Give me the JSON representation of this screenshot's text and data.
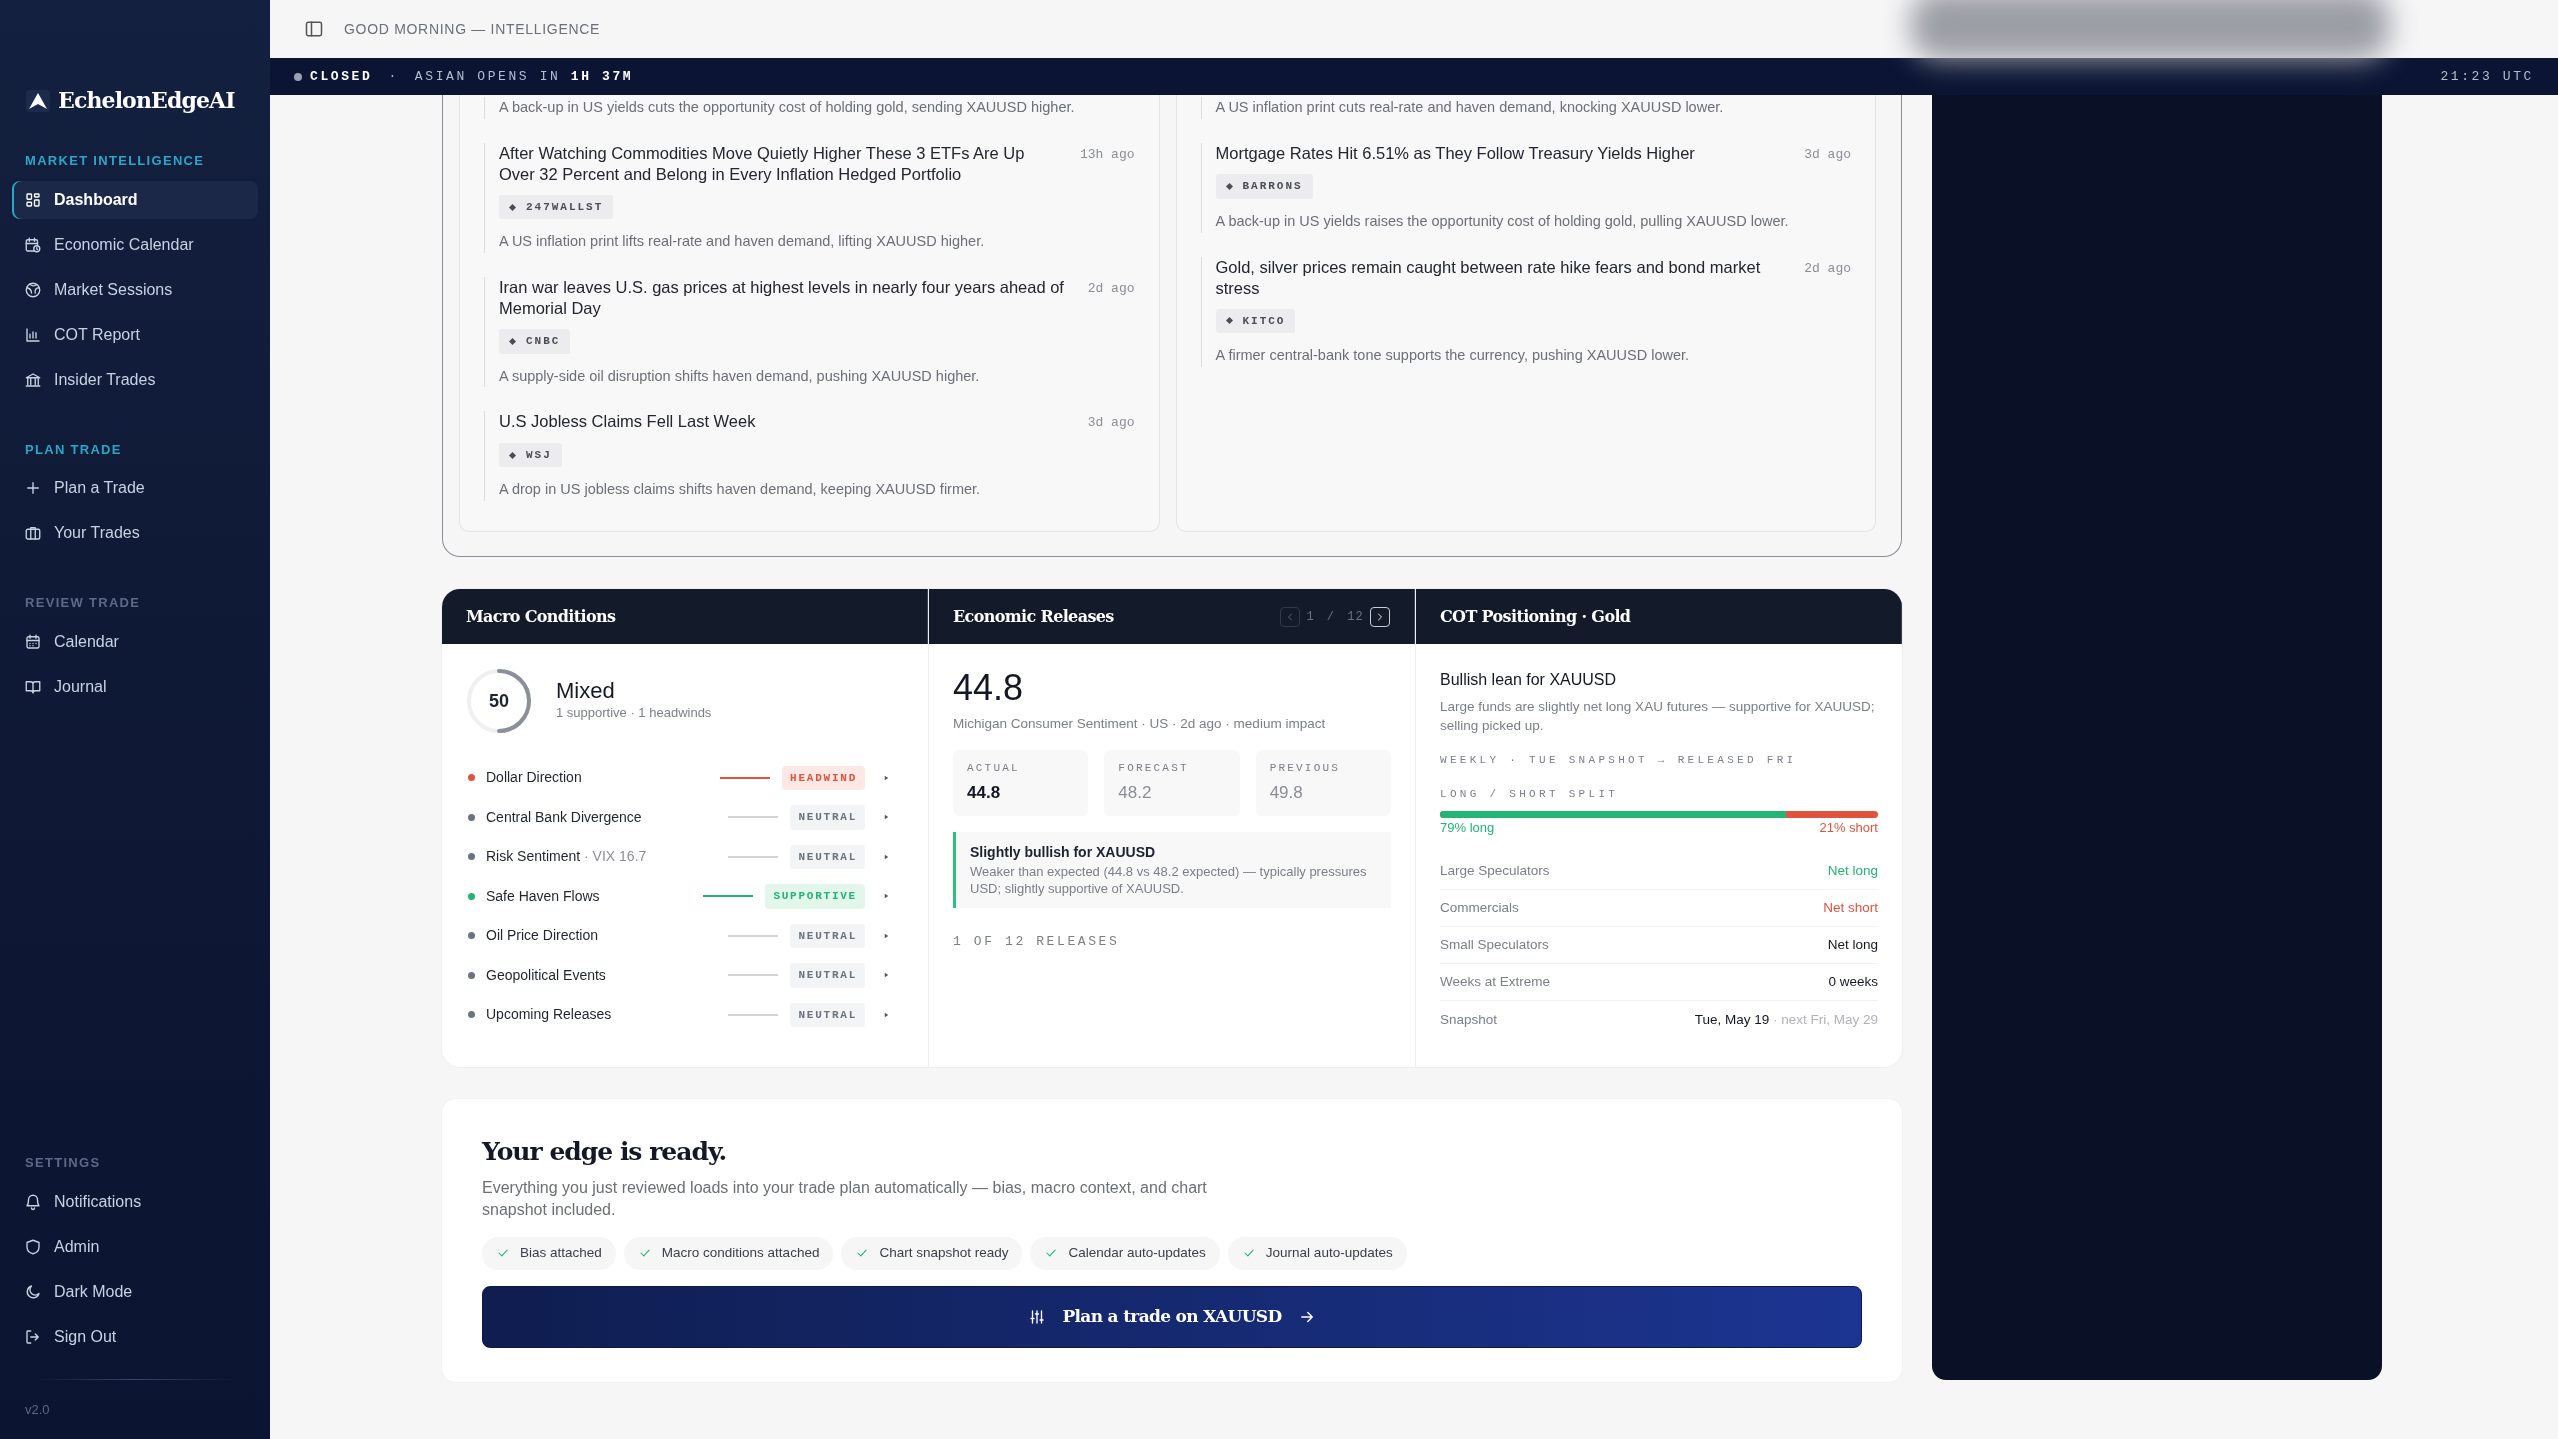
{
  "header": {
    "title": "GOOD MORNING — INTELLIGENCE"
  },
  "status_bar": {
    "state": "CLOSED",
    "separator": "·",
    "countdown_label": "ASIAN OPENS IN",
    "countdown": "1H 37M",
    "clock": "21:23 UTC"
  },
  "sidebar": {
    "brand": "EchelonEdgeAI",
    "sections": [
      {
        "title": "MARKET INTELLIGENCE",
        "accent": true,
        "items": [
          {
            "label": "Dashboard",
            "selected": true
          },
          {
            "label": "Economic Calendar",
            "selected": false
          },
          {
            "label": "Market Sessions",
            "selected": false
          },
          {
            "label": "COT Report",
            "selected": false
          },
          {
            "label": "Insider Trades",
            "selected": false
          }
        ]
      },
      {
        "title": "PLAN TRADE",
        "accent": true,
        "items": [
          {
            "label": "Plan a Trade",
            "selected": false
          },
          {
            "label": "Your Trades",
            "selected": false
          }
        ]
      },
      {
        "title": "REVIEW TRADE",
        "accent": false,
        "items": [
          {
            "label": "Calendar",
            "selected": false
          },
          {
            "label": "Journal",
            "selected": false
          }
        ]
      },
      {
        "title": "SETTINGS",
        "accent": false,
        "items": [
          {
            "label": "Notifications",
            "selected": false
          },
          {
            "label": "Admin",
            "selected": false
          },
          {
            "label": "Dark Mode",
            "selected": false
          },
          {
            "label": "Sign Out",
            "selected": false
          }
        ]
      }
    ],
    "version": "v2.0"
  },
  "news": {
    "columns": [
      [
        {
          "summary": "A back-up in US yields cuts the opportunity cost of holding gold, sending XAUUSD higher."
        },
        {
          "title": "After Watching Commodities Move Quietly Higher These 3 ETFs Are Up Over 32 Percent and Belong in Every Inflation Hedged Portfolio",
          "time": "13h ago",
          "source": "247WALLST",
          "summary": "A US inflation print lifts real-rate and haven demand, lifting XAUUSD higher."
        },
        {
          "title": "Iran war leaves U.S. gas prices at highest levels in nearly four years ahead of Memorial Day",
          "time": "2d ago",
          "source": "CNBC",
          "summary": "A supply-side oil disruption shifts haven demand, pushing XAUUSD higher."
        },
        {
          "title": "U.S Jobless Claims Fell Last Week",
          "time": "3d ago",
          "source": "WSJ",
          "summary": "A drop in US jobless claims shifts haven demand, keeping XAUUSD firmer."
        }
      ],
      [
        {
          "summary": "A US inflation print cuts real-rate and haven demand, knocking XAUUSD lower."
        },
        {
          "title": "Mortgage Rates Hit 6.51% as They Follow Treasury Yields Higher",
          "time": "3d ago",
          "source": "BARRONS",
          "summary": "A back-up in US yields raises the opportunity cost of holding gold, pulling XAUUSD lower."
        },
        {
          "title": "Gold, silver prices remain caught between rate hike fears and bond market stress",
          "time": "2d ago",
          "source": "KITCO",
          "summary": "A firmer central-bank tone supports the currency, pushing XAUUSD lower."
        }
      ]
    ]
  },
  "macro": {
    "title": "Macro Conditions",
    "score": "50",
    "level": 0.5,
    "verdict": "Mixed",
    "counts": "1 supportive · 1 headwinds",
    "factors": [
      {
        "label": "Dollar Direction",
        "signal": "HEADWIND",
        "kind": "headwind"
      },
      {
        "label": "Central Bank Divergence",
        "signal": "NEUTRAL",
        "kind": "neutral"
      },
      {
        "label": "Risk Sentiment",
        "note": "· VIX 16.7",
        "signal": "NEUTRAL",
        "kind": "neutral"
      },
      {
        "label": "Safe Haven Flows",
        "signal": "SUPPORTIVE",
        "kind": "supportive"
      },
      {
        "label": "Oil Price Direction",
        "signal": "NEUTRAL",
        "kind": "neutral"
      },
      {
        "label": "Geopolitical Events",
        "signal": "NEUTRAL",
        "kind": "neutral"
      },
      {
        "label": "Upcoming Releases",
        "signal": "NEUTRAL",
        "kind": "neutral"
      }
    ]
  },
  "releases": {
    "title": "Economic Releases",
    "pager": {
      "page": "1",
      "separator": "/",
      "total": "12",
      "prev_disabled": true
    },
    "value": "44.8",
    "meta": "Michigan Consumer Sentiment · US · 2d ago · medium impact",
    "stats": [
      {
        "label": "ACTUAL",
        "value": "44.8",
        "emphasis": true
      },
      {
        "label": "FORECAST",
        "value": "48.2",
        "emphasis": false
      },
      {
        "label": "PREVIOUS",
        "value": "49.8",
        "emphasis": false
      }
    ],
    "verdict": {
      "title": "Slightly bullish for XAUUSD",
      "text": "Weaker than expected (44.8 vs 48.2 expected) — typically pressures USD; slightly supportive of XAUUSD."
    },
    "footer": "1 OF 12 RELEASES"
  },
  "cot": {
    "title": "COT Positioning · Gold",
    "lean": "Bullish lean for XAUUSD",
    "text": "Large funds are slightly net long XAU futures — supportive for XAUUSD; selling picked up.",
    "schedule": "WEEKLY · TUE SNAPSHOT → RELEASED FRI",
    "split_label": "LONG / SHORT SPLIT",
    "level": 0.79,
    "long_label": "79% long",
    "short_label": "21% short",
    "rows": [
      {
        "label": "Large Speculators",
        "value": "Net long",
        "kind": "long"
      },
      {
        "label": "Commercials",
        "value": "Net short",
        "kind": "short"
      },
      {
        "label": "Small Speculators",
        "value": "Net long",
        "kind": "plain"
      },
      {
        "label": "Weeks at Extreme",
        "value": "0 weeks",
        "kind": "plain"
      },
      {
        "label": "Snapshot",
        "value": "Tue, May 19",
        "note": "· next Fri, May 29",
        "kind": "plain"
      }
    ]
  },
  "edge": {
    "title": "Your edge is ready.",
    "text": "Everything you just reviewed loads into your trade plan automatically — bias, macro context, and chart snapshot included.",
    "chips": [
      "Bias attached",
      "Macro conditions attached",
      "Chart snapshot ready",
      "Calendar auto-updates",
      "Journal auto-updates"
    ],
    "button": "Plan a trade on XAUUSD"
  }
}
